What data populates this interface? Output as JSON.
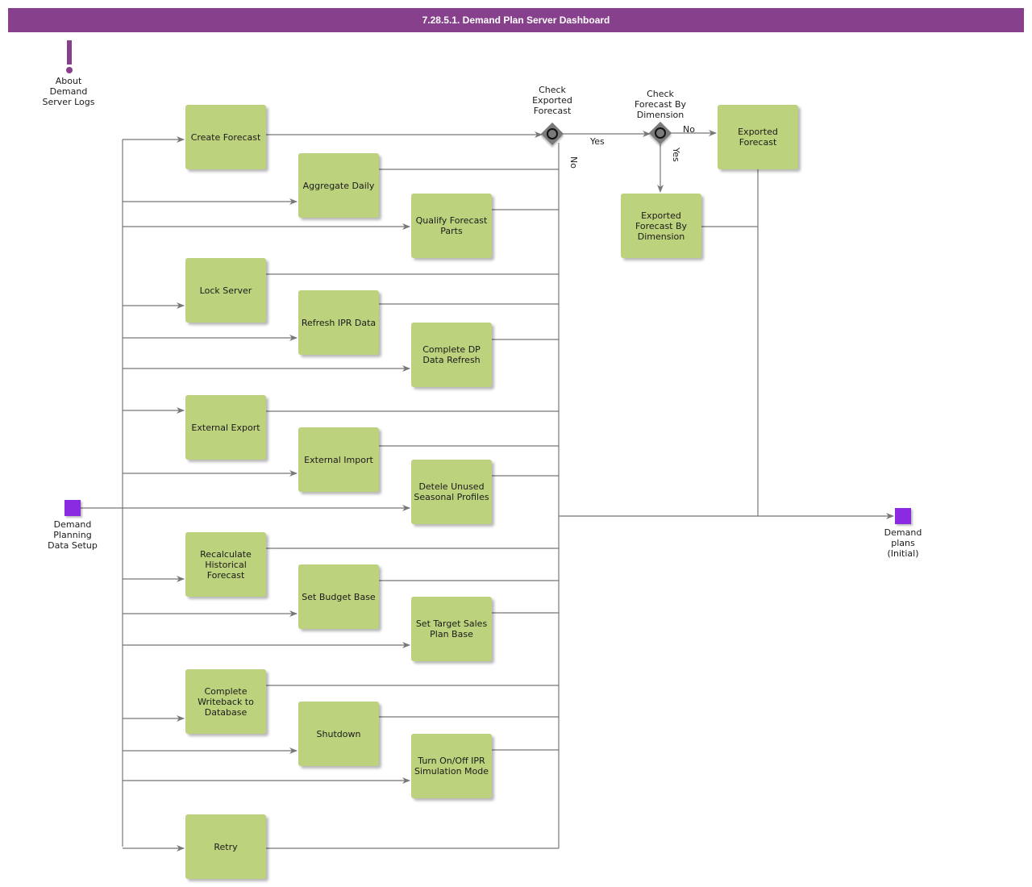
{
  "title": "7.28.5.1. Demand Plan Server Dashboard",
  "colors": {
    "title_bar": "#87418c",
    "task_fill": "#bdd27c",
    "event_fill": "#8a2be2",
    "gateway_fill": "#7a7a7a",
    "connector": "#777777"
  },
  "annotation": {
    "icon": "exclamation-icon",
    "label": "About\nDemand\nServer Logs"
  },
  "start_event": {
    "label": "Demand\nPlanning\nData Setup"
  },
  "end_event": {
    "label": "Demand\nplans\n(Initial)"
  },
  "tasks": [
    {
      "id": "create-forecast",
      "label": "Create Forecast"
    },
    {
      "id": "aggregate-daily",
      "label": "Aggregate Daily"
    },
    {
      "id": "qualify-forecast-parts",
      "label": "Qualify Forecast Parts"
    },
    {
      "id": "lock-server",
      "label": "Lock Server"
    },
    {
      "id": "refresh-ipr-data",
      "label": "Refresh IPR Data"
    },
    {
      "id": "complete-dp-data-refresh",
      "label": "Complete DP Data Refresh"
    },
    {
      "id": "external-export",
      "label": "External Export"
    },
    {
      "id": "external-import",
      "label": "External Import"
    },
    {
      "id": "delete-unused-seasonal-profiles",
      "label": "Detele Unused Seasonal Profiles"
    },
    {
      "id": "recalculate-historical-forecast",
      "label": "Recalculate Historical Forecast"
    },
    {
      "id": "set-budget-base",
      "label": "Set Budget Base"
    },
    {
      "id": "set-target-sales-plan-base",
      "label": "Set Target Sales Plan Base"
    },
    {
      "id": "complete-writeback-to-database",
      "label": "Complete Writeback to Database"
    },
    {
      "id": "shutdown",
      "label": "Shutdown"
    },
    {
      "id": "turn-on-off-ipr-simulation-mode",
      "label": "Turn On/Off IPR Simulation Mode"
    },
    {
      "id": "retry",
      "label": "Retry"
    },
    {
      "id": "exported-forecast",
      "label": "Exported Forecast"
    },
    {
      "id": "exported-forecast-by-dimension",
      "label": "Exported Forecast By Dimension"
    }
  ],
  "gateways": [
    {
      "id": "check-exported-forecast",
      "label": "Check\nExported\nForecast",
      "yes": "Yes",
      "no": "No"
    },
    {
      "id": "check-forecast-by-dimension",
      "label": "Check\nForecast By\nDimension",
      "yes": "Yes",
      "no": "No"
    }
  ]
}
